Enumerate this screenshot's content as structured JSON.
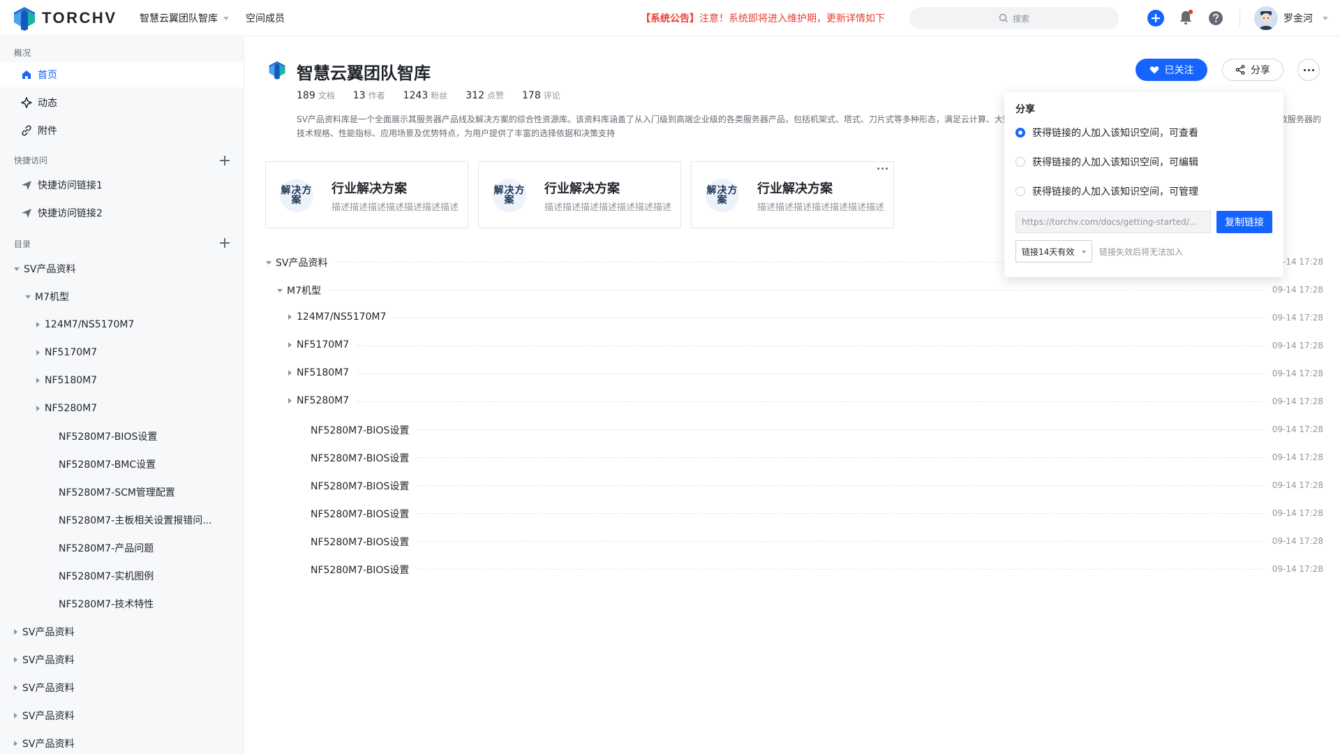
{
  "header": {
    "logo_text": "TORCHV",
    "space_name": "智慧云翼团队智库",
    "members_link": "空间成员",
    "announcement_tag": "【系统公告】",
    "announcement_text": "注意！系统即将进入维护期，更新详情如下",
    "search_placeholder": "搜索",
    "username": "罗金河",
    "accent_color": "#1664ff",
    "alert_color": "#e63f32"
  },
  "sidebar": {
    "overview_title": "概况",
    "nav": [
      {
        "label": "首页",
        "icon": "home-icon",
        "active": true
      },
      {
        "label": "动态",
        "icon": "activity-icon",
        "active": false
      },
      {
        "label": "附件",
        "icon": "attachment-icon",
        "active": false
      }
    ],
    "quick_title": "快捷访问",
    "quick_links": [
      "快捷访问链接1",
      "快捷访问链接2"
    ],
    "catalog_title": "目录",
    "tree": [
      {
        "label": "SV产品资料",
        "state": "expanded"
      },
      {
        "label": "M7机型",
        "state": "expanded"
      },
      {
        "label": "124M7/NS5170M7",
        "state": "collapsed"
      },
      {
        "label": "NF5170M7",
        "state": "collapsed"
      },
      {
        "label": "NF5180M7",
        "state": "collapsed"
      },
      {
        "label": "NF5280M7",
        "state": "collapsed"
      },
      {
        "label": "NF5280M7-BIOS设置",
        "state": "leaf"
      },
      {
        "label": "NF5280M7-BMC设置",
        "state": "leaf"
      },
      {
        "label": "NF5280M7-SCM管理配置",
        "state": "leaf"
      },
      {
        "label": "NF5280M7-主板相关设置报错问...",
        "state": "leaf"
      },
      {
        "label": "NF5280M7-产品问题",
        "state": "leaf"
      },
      {
        "label": "NF5280M7-实机图例",
        "state": "leaf"
      },
      {
        "label": "NF5280M7-技术特性",
        "state": "leaf"
      },
      {
        "label": "SV产品资料",
        "state": "collapsed"
      },
      {
        "label": "SV产品资料",
        "state": "collapsed"
      },
      {
        "label": "SV产品资料",
        "state": "collapsed"
      },
      {
        "label": "SV产品资料",
        "state": "collapsed"
      },
      {
        "label": "SV产品资料",
        "state": "collapsed"
      }
    ]
  },
  "main": {
    "title": "智慧云翼团队智库",
    "stats": [
      {
        "num": "189",
        "unit": "文档"
      },
      {
        "num": "13",
        "unit": "作者"
      },
      {
        "num": "1243",
        "unit": "粉丝"
      },
      {
        "num": "312",
        "unit": "点赞"
      },
      {
        "num": "178",
        "unit": "评论"
      }
    ],
    "description": "SV产品资料库是一个全面展示其服务器产品线及解决方案的综合性资源库。该资料库涵盖了从入门级到高端企业级的各类服务器产品，包括机架式、塔式、刀片式等多种形态，满足云计算、大数据、人工智能等多种应用场景的需求。用户可以通过该资料库详细了解每款服务器的技术规格、性能指标、应用场景及优势特点，为用户提供了丰富的选择依据和决策支持",
    "follow_label": "已关注",
    "share_label": "分享",
    "cards": [
      {
        "img_text": "解决方案",
        "title": "行业解决方案",
        "desc": "描述描述描述描述描述描述描述"
      },
      {
        "img_text": "解决方案",
        "title": "行业解决方案",
        "desc": "描述描述描述描述描述描述描述"
      },
      {
        "img_text": "解决方案",
        "title": "行业解决方案",
        "desc": "描述描述描述描述描述描述描述"
      }
    ],
    "docs": [
      {
        "name": "SV产品资料",
        "date": "09-14 17:28",
        "level": 0,
        "state": "expanded"
      },
      {
        "name": "M7机型",
        "date": "09-14 17:28",
        "level": 1,
        "state": "expanded"
      },
      {
        "name": "124M7/NS5170M7",
        "date": "09-14 17:28",
        "level": 2,
        "state": "collapsed"
      },
      {
        "name": "NF5170M7",
        "date": "09-14 17:28",
        "level": 2,
        "state": "collapsed"
      },
      {
        "name": "NF5180M7",
        "date": "09-14 17:28",
        "level": 2,
        "state": "collapsed"
      },
      {
        "name": "NF5280M7",
        "date": "09-14 17:28",
        "level": 2,
        "state": "collapsed"
      },
      {
        "name": "NF5280M7-BIOS设置",
        "date": "09-14 17:28",
        "level": 3,
        "state": "leaf"
      },
      {
        "name": "NF5280M7-BIOS设置",
        "date": "09-14 17:28",
        "level": 3,
        "state": "leaf"
      },
      {
        "name": "NF5280M7-BIOS设置",
        "date": "09-14 17:28",
        "level": 3,
        "state": "leaf"
      },
      {
        "name": "NF5280M7-BIOS设置",
        "date": "09-14 17:28",
        "level": 3,
        "state": "leaf"
      },
      {
        "name": "NF5280M7-BIOS设置",
        "date": "09-14 17:28",
        "level": 3,
        "state": "leaf"
      },
      {
        "name": "NF5280M7-BIOS设置",
        "date": "09-14 17:28",
        "level": 3,
        "state": "leaf"
      }
    ]
  },
  "share_popover": {
    "title": "分享",
    "options": [
      {
        "label": "获得链接的人加入该知识空间，可查看",
        "selected": true
      },
      {
        "label": "获得链接的人加入该知识空间，可编辑",
        "selected": false
      },
      {
        "label": "获得链接的人加入该知识空间，可管理",
        "selected": false
      }
    ],
    "link_value": "https://torchv.com/docs/getting-started/...",
    "copy_label": "复制链接",
    "expire_value": "链接14天有效",
    "expire_note": "链接失效后将无法加入"
  }
}
